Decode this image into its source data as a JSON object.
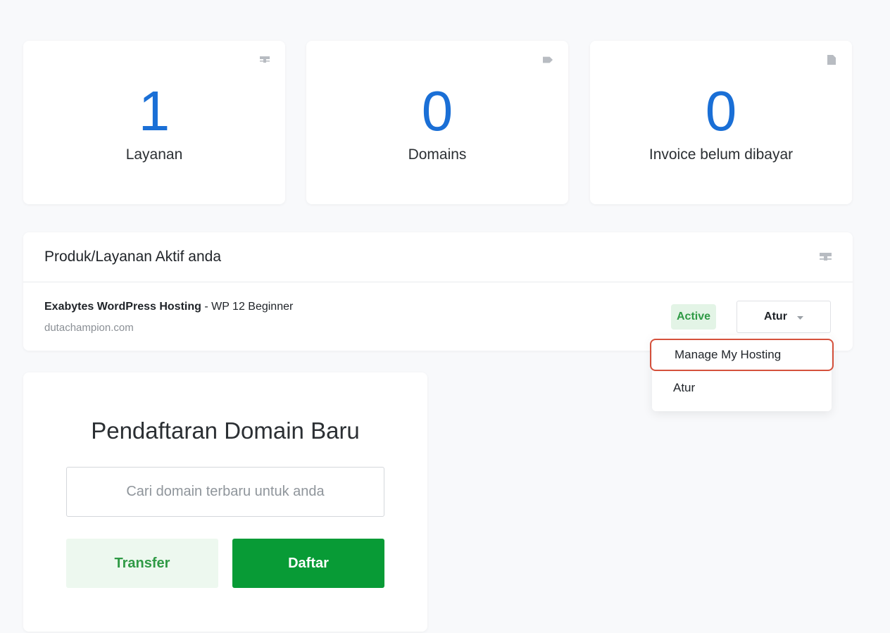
{
  "stats": [
    {
      "count": "1",
      "label": "Layanan",
      "icon": "server-icon"
    },
    {
      "count": "0",
      "label": "Domains",
      "icon": "tag-icon"
    },
    {
      "count": "0",
      "label": "Invoice belum dibayar",
      "icon": "document-icon"
    }
  ],
  "services_panel": {
    "title": "Produk/Layanan Aktif anda",
    "header_icon": "server-icon",
    "service": {
      "product_name": "Exabytes WordPress Hosting",
      "plan": " - WP 12 Beginner",
      "domain": "dutachampion.com",
      "status": "Active",
      "action_label": "Atur"
    }
  },
  "dropdown_menu": {
    "items": [
      "Manage My Hosting",
      "Atur"
    ]
  },
  "domain_registration": {
    "title": "Pendaftaran Domain Baru",
    "search_placeholder": "Cari domain terbaru untuk anda",
    "transfer_label": "Transfer",
    "register_label": "Daftar"
  },
  "colors": {
    "accent_blue": "#1a6fd6",
    "brand_green": "#089b36",
    "status_green": "#2f9a45",
    "highlight_red": "#d5513c"
  }
}
